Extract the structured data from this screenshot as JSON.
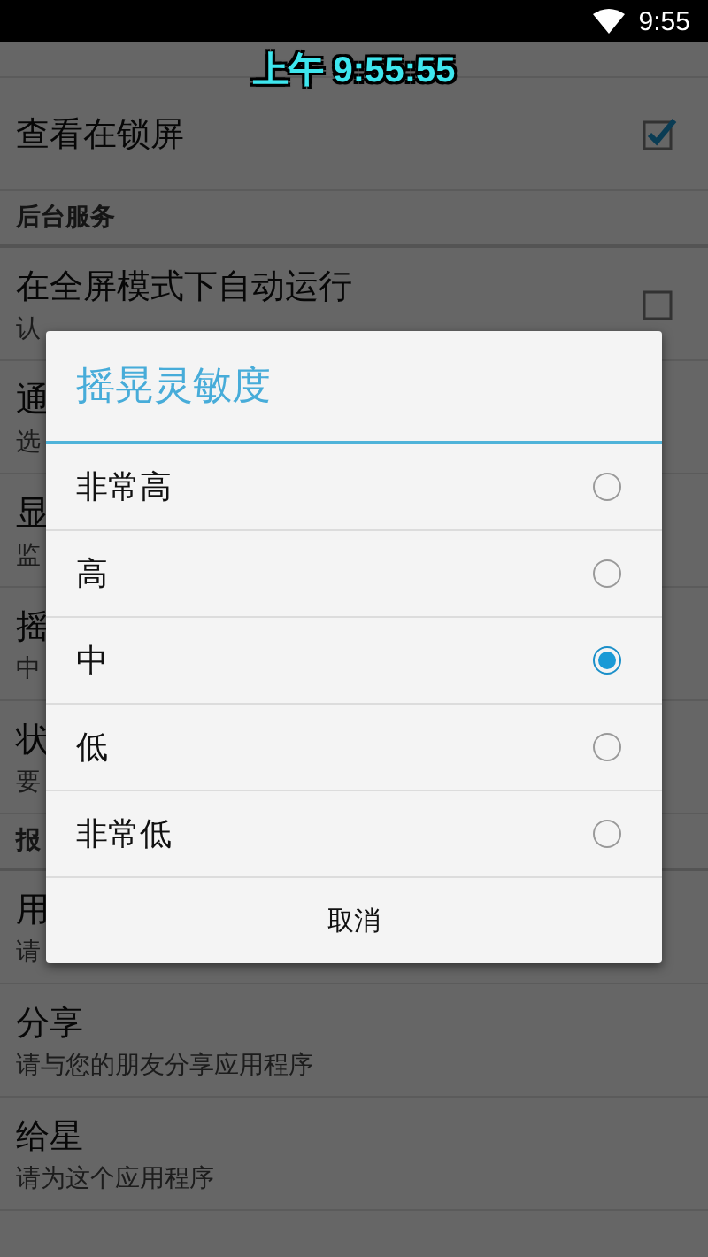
{
  "status_bar": {
    "time": "9:55"
  },
  "clock_overlay": "上午 9:55:55",
  "settings": [
    {
      "kind": "item",
      "title": "查看在锁屏",
      "checked": true
    },
    {
      "kind": "header",
      "title": "后台服务"
    },
    {
      "kind": "item",
      "title": "在全屏模式下自动运行",
      "subtitle": "认",
      "checked": false
    },
    {
      "kind": "item",
      "title": "通",
      "subtitle": "选"
    },
    {
      "kind": "item",
      "title": "显",
      "subtitle": "监"
    },
    {
      "kind": "item",
      "title": "摇",
      "subtitle": "中"
    },
    {
      "kind": "item",
      "title": "状",
      "subtitle": "要"
    },
    {
      "kind": "header",
      "title": "报"
    },
    {
      "kind": "item",
      "title": "用",
      "subtitle": "请"
    },
    {
      "kind": "item",
      "title": "分享",
      "subtitle": "请与您的朋友分享应用程序"
    },
    {
      "kind": "item",
      "title": "给星",
      "subtitle": "请为这个应用程序"
    }
  ],
  "dialog": {
    "title": "摇晃灵敏度",
    "options": [
      {
        "label": "非常高",
        "selected": false
      },
      {
        "label": "高",
        "selected": false
      },
      {
        "label": "中",
        "selected": true
      },
      {
        "label": "低",
        "selected": false
      },
      {
        "label": "非常低",
        "selected": false
      }
    ],
    "buttons": [
      "取消"
    ]
  }
}
